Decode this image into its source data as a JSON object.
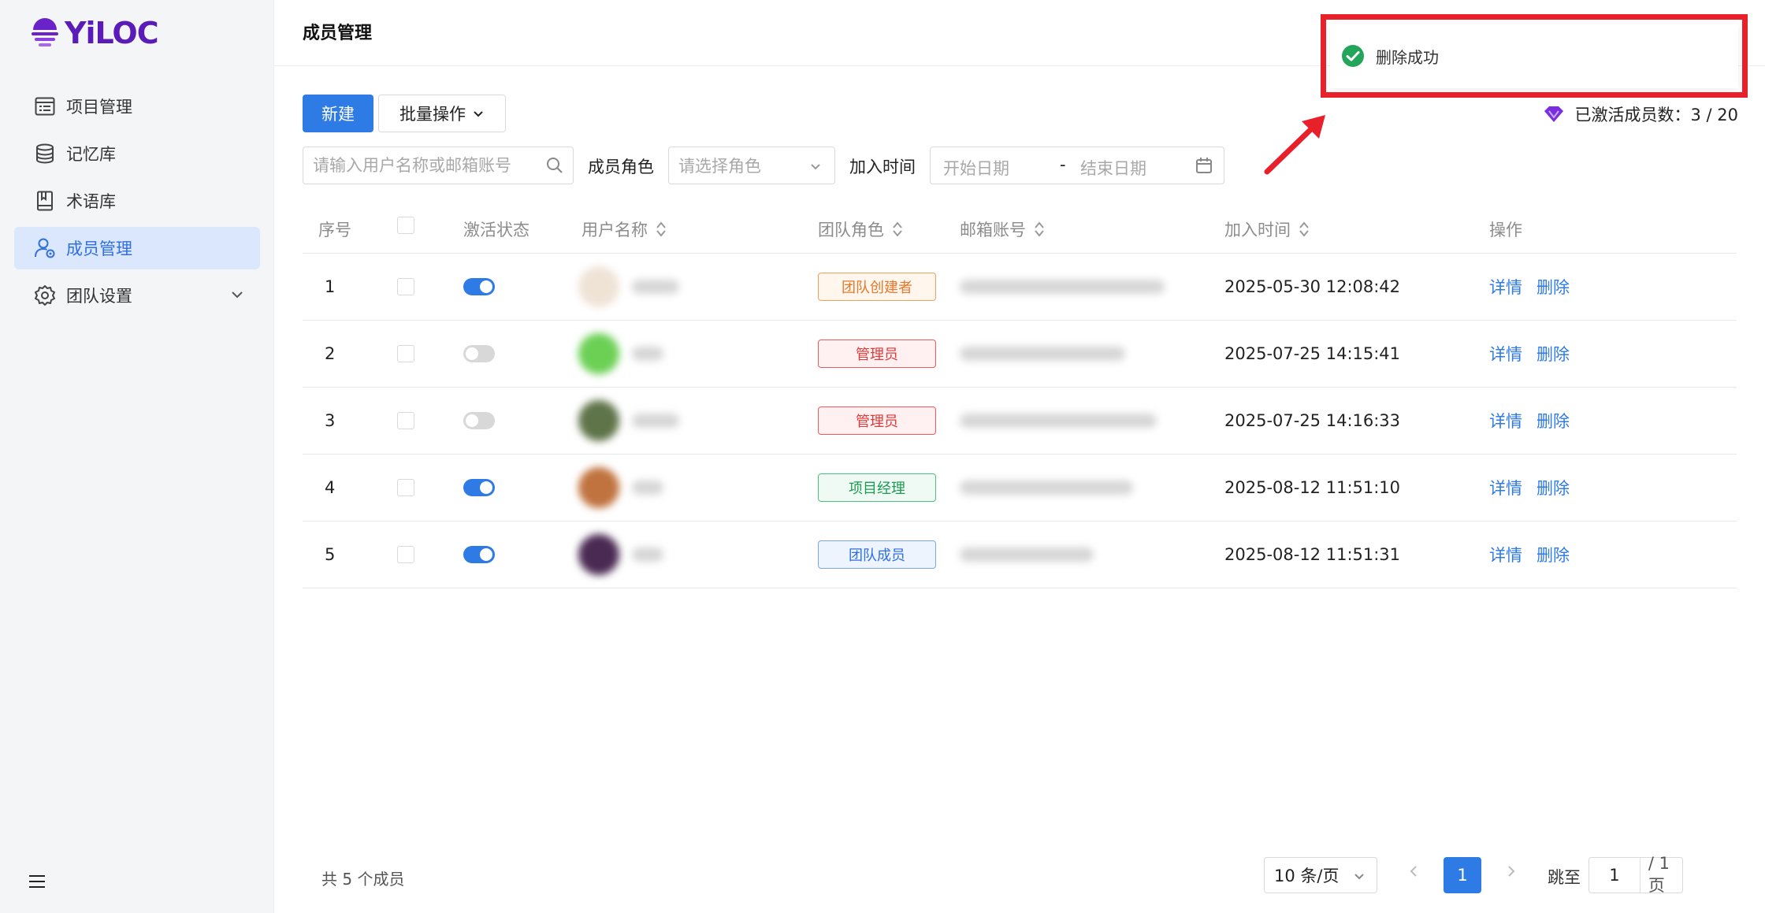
{
  "app": {
    "logo_text": "YiLOC"
  },
  "sidebar": {
    "items": [
      {
        "label": "项目管理",
        "icon": "project-list-icon"
      },
      {
        "label": "记忆库",
        "icon": "database-icon"
      },
      {
        "label": "术语库",
        "icon": "book-icon"
      },
      {
        "label": "成员管理",
        "icon": "member-icon",
        "active": true
      },
      {
        "label": "团队设置",
        "icon": "gear-icon",
        "expandable": true
      }
    ]
  },
  "header": {
    "title": "成员管理"
  },
  "toolbar": {
    "new_label": "新建",
    "batch_label": "批量操作",
    "active_members_label": "已激活成员数：",
    "active_members_value": "3 / 20"
  },
  "filters": {
    "search_placeholder": "请输入用户名称或邮箱账号",
    "role_label": "成员角色",
    "role_placeholder": "请选择角色",
    "join_time_label": "加入时间",
    "start_date_placeholder": "开始日期",
    "range_separator": "-",
    "end_date_placeholder": "结束日期"
  },
  "table": {
    "headers": {
      "index": "序号",
      "status": "激活状态",
      "username": "用户名称",
      "role": "团队角色",
      "email": "邮箱账号",
      "join_time": "加入时间",
      "actions": "操作"
    },
    "rows": [
      {
        "index": "1",
        "active": true,
        "avatar_color": "#efe3d6",
        "role": "团队创建者",
        "role_style": "orange",
        "join_time": "2025-05-30 12:08:42"
      },
      {
        "index": "2",
        "active": false,
        "avatar_color": "#6cd055",
        "role": "管理员",
        "role_style": "red",
        "join_time": "2025-07-25 14:15:41"
      },
      {
        "index": "3",
        "active": false,
        "avatar_color": "#5f7449",
        "role": "管理员",
        "role_style": "red",
        "join_time": "2025-07-25 14:16:33"
      },
      {
        "index": "4",
        "active": true,
        "avatar_color": "#c0733f",
        "role": "项目经理",
        "role_style": "green",
        "join_time": "2025-08-12 11:51:10"
      },
      {
        "index": "5",
        "active": true,
        "avatar_color": "#4a2a52",
        "role": "团队成员",
        "role_style": "blue",
        "join_time": "2025-08-12 11:51:31"
      }
    ],
    "action_detail": "详情",
    "action_delete": "删除"
  },
  "footer": {
    "total": "共 5 个成员",
    "page_size": "10 条/页",
    "current_page": "1",
    "jump_label": "跳至",
    "jump_value": "1",
    "total_pages": "/ 1 页"
  },
  "toast": {
    "message": "删除成功"
  },
  "colors": {
    "primary": "#2f7be6",
    "brand": "#5a1bb8",
    "annotation": "#e8202a",
    "success": "#23a55a"
  }
}
